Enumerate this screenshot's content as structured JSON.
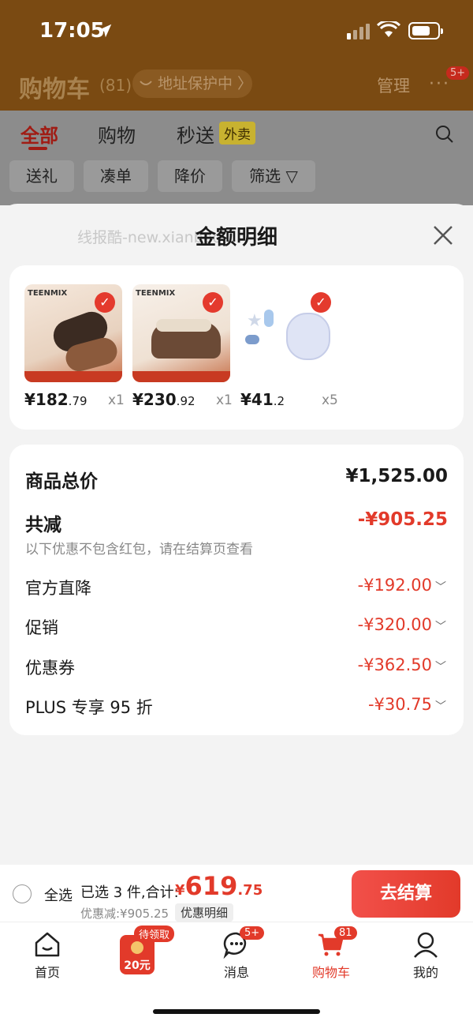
{
  "status_bar": {
    "time": "17:05"
  },
  "header": {
    "title": "购物车",
    "count": "(81)",
    "address": "地址保护中 〉",
    "manage": "管理",
    "more_badge": "5+"
  },
  "tabs": {
    "all": "全部",
    "shopping": "购物",
    "express": "秒送",
    "takeout": "外卖"
  },
  "filters": [
    "送礼",
    "凑单",
    "降价",
    "筛选"
  ],
  "sheet": {
    "title": "金额明细",
    "watermark": "线报酷-new.xianbao..."
  },
  "products": [
    {
      "brand": "TEENMIX",
      "price_int": "¥182",
      "price_dec": ".79",
      "qty": "x1"
    },
    {
      "brand": "TEENMIX",
      "price_int": "¥230",
      "price_dec": ".92",
      "qty": "x1"
    },
    {
      "brand": "",
      "price_int": "¥41",
      "price_dec": ".2",
      "qty": "x5"
    }
  ],
  "summary": {
    "total_label": "商品总价",
    "total_value": "¥1,525.00",
    "reduce_label": "共减",
    "reduce_value": "-¥905.25",
    "note": "以下优惠不包含红包，请在结算页查看",
    "items": [
      {
        "label": "官方直降",
        "value": "-¥192.00"
      },
      {
        "label": "促销",
        "value": "-¥320.00"
      },
      {
        "label": "优惠券",
        "value": "-¥362.50"
      },
      {
        "label": "PLUS 专享 95 折",
        "value": "-¥30.75"
      }
    ]
  },
  "bottom": {
    "select_all": "全选",
    "selected": "已选 3 件,合计:",
    "currency": "¥",
    "total_int": "619",
    "total_dec": ".75",
    "discount": "优惠减:¥905.25",
    "detail": "优惠明细",
    "checkout": "去结算"
  },
  "nav": {
    "home": "首页",
    "redpacket_badge": "待领取",
    "redpacket_amount": "20元",
    "messages": "消息",
    "messages_badge": "5+",
    "cart": "购物车",
    "cart_badge": "81",
    "me": "我的"
  },
  "colors": {
    "accent": "#e23a2a",
    "active_nav": "#e23a2a"
  }
}
